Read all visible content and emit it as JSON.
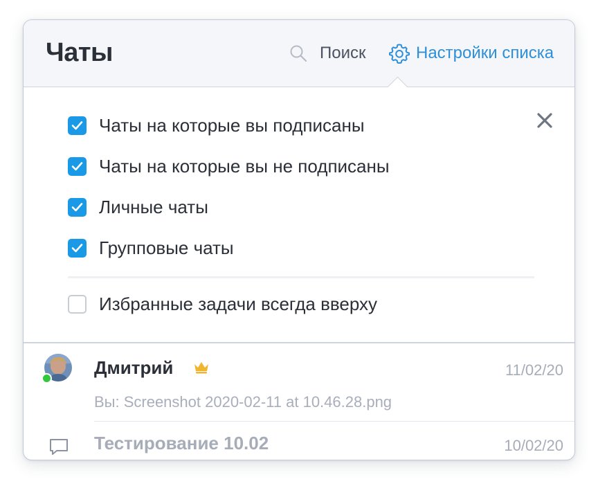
{
  "header": {
    "title": "Чаты",
    "search_label": "Поиск",
    "search_icon": "search-icon",
    "settings_label": "Настройки списка",
    "settings_icon": "gear-icon"
  },
  "filters": {
    "close_icon": "close-icon",
    "options": [
      {
        "label": "Чаты на которые вы подписаны",
        "checked": true
      },
      {
        "label": "Чаты на которые вы не подписаны",
        "checked": true
      },
      {
        "label": "Личные чаты",
        "checked": true
      },
      {
        "label": "Групповые чаты",
        "checked": true
      },
      {
        "label": "Избранные задачи всегда вверху",
        "checked": false
      }
    ]
  },
  "chats": [
    {
      "name": "Дмитрий",
      "date": "11/02/20",
      "preview": "Вы: Screenshot 2020-02-11 at 10.46.28.png",
      "online": true,
      "badge_icon": "crown-icon"
    },
    {
      "name": "Тестирование 10.02",
      "date": "10/02/20",
      "icon": "chat-bubble-icon"
    }
  ],
  "colors": {
    "accent": "#2e8fd8",
    "checkbox": "#1a9ae6",
    "online": "#33c73a",
    "crown": "#f2b32e",
    "header_bg": "#f4f6f9"
  }
}
